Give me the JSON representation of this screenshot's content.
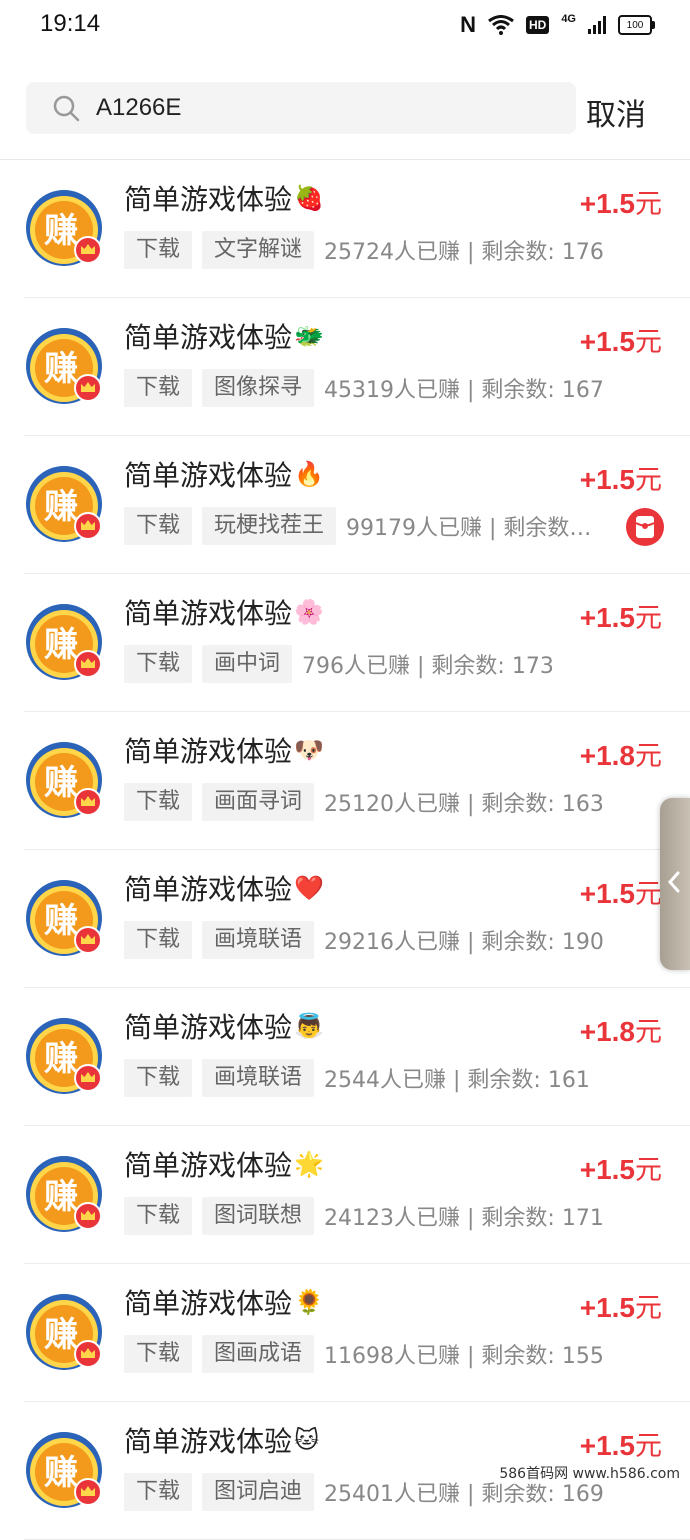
{
  "status_bar": {
    "time": "19:14",
    "nfc": "N",
    "hd": "HD",
    "network": "4G",
    "battery": "100"
  },
  "search": {
    "query": "A1266E",
    "cancel_label": "取消"
  },
  "colors": {
    "accent_red": "#e9343a",
    "tag_bg": "#f2f2f2",
    "avatar_orange": "#f39a1c",
    "avatar_blue": "#2a63b8"
  },
  "avatar_glyph": "赚",
  "list": {
    "items": [
      {
        "title": "简单游戏体验",
        "emoji": "🍓",
        "reward": "+1.5",
        "unit": "元",
        "tag1": "下载",
        "tag2": "文字解谜",
        "meta": "25724人已赚 | 剩余数: 176"
      },
      {
        "title": "简单游戏体验",
        "emoji": "🐲",
        "reward": "+1.5",
        "unit": "元",
        "tag1": "下载",
        "tag2": "图像探寻",
        "meta": "45319人已赚 | 剩余数: 167"
      },
      {
        "title": "简单游戏体验",
        "emoji": "🔥",
        "reward": "+1.5",
        "unit": "元",
        "tag1": "下载",
        "tag2": "玩梗找茬王",
        "meta": "99179人已赚 | 剩余数: ..."
      },
      {
        "title": "简单游戏体验",
        "emoji": "🌸",
        "reward": "+1.5",
        "unit": "元",
        "tag1": "下载",
        "tag2": "画中词",
        "meta": "796人已赚 | 剩余数: 173"
      },
      {
        "title": "简单游戏体验",
        "emoji": "🐶",
        "reward": "+1.8",
        "unit": "元",
        "tag1": "下载",
        "tag2": "画面寻词",
        "meta": "25120人已赚 | 剩余数: 163"
      },
      {
        "title": "简单游戏体验",
        "emoji": "❤️",
        "reward": "+1.5",
        "unit": "元",
        "tag1": "下载",
        "tag2": "画境联语",
        "meta": "29216人已赚 | 剩余数: 190"
      },
      {
        "title": "简单游戏体验",
        "emoji": "👼",
        "reward": "+1.8",
        "unit": "元",
        "tag1": "下载",
        "tag2": "画境联语",
        "meta": "2544人已赚 | 剩余数: 161"
      },
      {
        "title": "简单游戏体验",
        "emoji": "🌟",
        "reward": "+1.5",
        "unit": "元",
        "tag1": "下载",
        "tag2": "图词联想",
        "meta": "24123人已赚 | 剩余数: 171"
      },
      {
        "title": "简单游戏体验",
        "emoji": "🌻",
        "reward": "+1.5",
        "unit": "元",
        "tag1": "下载",
        "tag2": "图画成语",
        "meta": "11698人已赚 | 剩余数: 155"
      },
      {
        "title": "简单游戏体验",
        "emoji": "🐱",
        "reward": "+1.5",
        "unit": "元",
        "tag1": "下载",
        "tag2": "图词启迪",
        "meta": "25401人已赚 | 剩余数: 169"
      }
    ]
  },
  "watermark": "586首码网 www.h586.com"
}
